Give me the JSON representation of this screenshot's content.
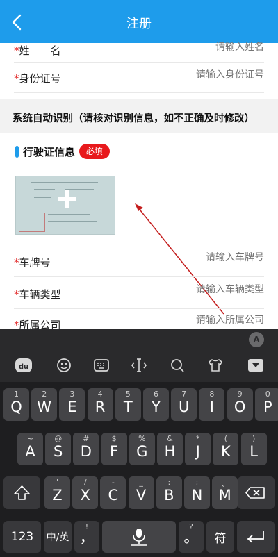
{
  "header": {
    "title": "注册"
  },
  "form": {
    "name": {
      "label": "姓　　名",
      "placeholder": "请输入姓名"
    },
    "id_number": {
      "label": "身份证号",
      "placeholder": "请输入身份证号"
    },
    "notice": "系统自动识别（请核对识别信息，如不正确及时修改）",
    "license_section": {
      "title": "行驶证信息",
      "badge": "必填"
    },
    "plate": {
      "label": "车牌号",
      "placeholder": "请输入车牌号"
    },
    "vehicle_type": {
      "label": "车辆类型",
      "placeholder": "请输入车辆类型"
    },
    "company": {
      "label": "所属公司",
      "placeholder": "请输入所属公司"
    },
    "required_mark": "*"
  },
  "keyboard": {
    "collapse_label": "A",
    "row1": [
      {
        "main": "Q",
        "sub": "1"
      },
      {
        "main": "W",
        "sub": "2"
      },
      {
        "main": "E",
        "sub": "3"
      },
      {
        "main": "R",
        "sub": "4"
      },
      {
        "main": "T",
        "sub": "5"
      },
      {
        "main": "Y",
        "sub": "6"
      },
      {
        "main": "U",
        "sub": "7"
      },
      {
        "main": "I",
        "sub": "8"
      },
      {
        "main": "O",
        "sub": "9"
      },
      {
        "main": "P",
        "sub": "0"
      }
    ],
    "row2": [
      {
        "main": "A",
        "sub": "~"
      },
      {
        "main": "S",
        "sub": "@"
      },
      {
        "main": "D",
        "sub": "#"
      },
      {
        "main": "F",
        "sub": "$"
      },
      {
        "main": "G",
        "sub": "%"
      },
      {
        "main": "H",
        "sub": "&"
      },
      {
        "main": "J",
        "sub": "*"
      },
      {
        "main": "K",
        "sub": "("
      },
      {
        "main": "L",
        "sub": ")"
      }
    ],
    "row3": [
      {
        "main": "Z",
        "sub": "'"
      },
      {
        "main": "X",
        "sub": "/"
      },
      {
        "main": "C",
        "sub": "-"
      },
      {
        "main": "V",
        "sub": "_"
      },
      {
        "main": "B",
        "sub": ":"
      },
      {
        "main": "N",
        "sub": ";"
      },
      {
        "main": "M",
        "sub": "、"
      }
    ],
    "bottom": {
      "num": "123",
      "lang": "中/英",
      "comma": "，",
      "comma_sub": "!",
      "period": "。",
      "period_sub": "?",
      "symbol": "符"
    }
  }
}
